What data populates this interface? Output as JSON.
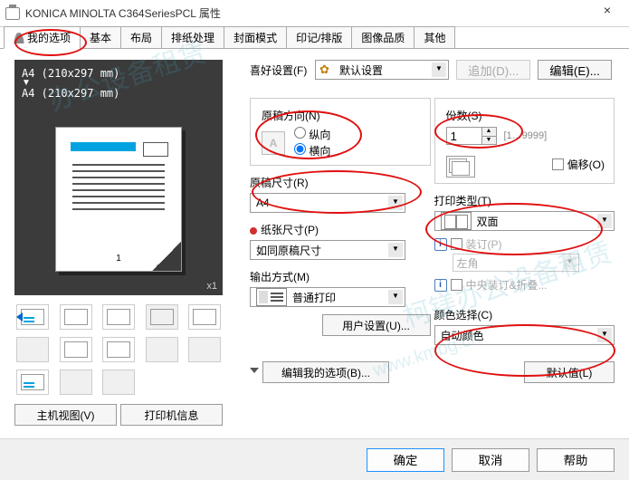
{
  "window": {
    "title": "KONICA MINOLTA C364SeriesPCL 属性",
    "close": "×"
  },
  "tabs": [
    "我的选项",
    "基本",
    "布局",
    "排纸处理",
    "封面模式",
    "印记/排版",
    "图像品质",
    "其他"
  ],
  "preview": {
    "size1": "A4 (210x297 mm)",
    "size2": "A4 (210x297 mm)",
    "zoom": "x1",
    "page_no": "1"
  },
  "left_buttons": {
    "host_view": "主机视图(V)",
    "printer_info": "打印机信息"
  },
  "fav": {
    "label": "喜好设置(F)",
    "value": "默认设置",
    "add": "追加(D)...",
    "edit": "编辑(E)..."
  },
  "orientation": {
    "title": "原稿方向(N)",
    "portrait": "纵向",
    "landscape": "横向"
  },
  "copies": {
    "title": "份数(S)",
    "value": "1",
    "range": "[1…9999]",
    "offset": "偏移(O)"
  },
  "original_size": {
    "label": "原稿尺寸(R)",
    "value": "A4"
  },
  "paper_size": {
    "label": "纸张尺寸(P)",
    "value": "如同原稿尺寸"
  },
  "print_type": {
    "label": "打印类型(T)",
    "value": "双面"
  },
  "output_method": {
    "label": "输出方式(M)",
    "value": "普通打印"
  },
  "binding": {
    "label": "装订(P)",
    "value": "左角"
  },
  "fold": {
    "label": "中央装订&折叠..."
  },
  "color_select": {
    "label": "颜色选择(C)",
    "value": "自动颜色"
  },
  "user_settings_btn": "用户设置(U)...",
  "edit_my_options_btn": "编辑我的选项(B)...",
  "default_btn": "默认值(L)",
  "dialog_buttons": {
    "ok": "确定",
    "cancel": "取消",
    "help": "帮助"
  }
}
